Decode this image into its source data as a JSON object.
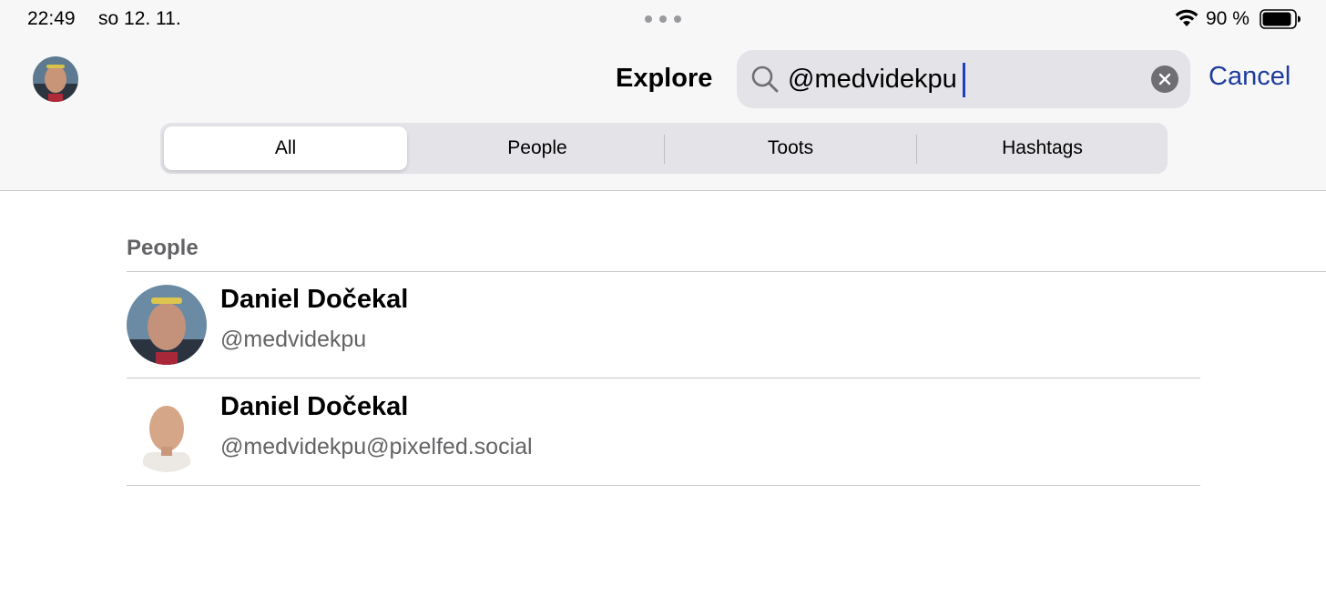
{
  "status_bar": {
    "time": "22:49",
    "date": "so 12. 11.",
    "battery_percent": "90 %",
    "battery_level": 0.9,
    "wifi_icon": "wifi-icon",
    "battery_icon": "battery-icon"
  },
  "nav": {
    "title": "Explore",
    "cancel_label": "Cancel"
  },
  "search": {
    "value": "@medvidekpu",
    "icon": "search-icon",
    "clear_icon": "clear-icon"
  },
  "segments": [
    {
      "label": "All",
      "selected": true
    },
    {
      "label": "People",
      "selected": false
    },
    {
      "label": "Toots",
      "selected": false
    },
    {
      "label": "Hashtags",
      "selected": false
    }
  ],
  "results": {
    "section_title": "People",
    "people": [
      {
        "name": "Daniel Dočekal",
        "handle": "@medvidekpu"
      },
      {
        "name": "Daniel Dočekal",
        "handle": "@medvidekpu@pixelfed.social"
      }
    ]
  },
  "colors": {
    "accent": "#1e3c9e",
    "header_bg": "#f7f7f7",
    "segment_bg": "#e3e3e8",
    "secondary_text": "#636366"
  }
}
